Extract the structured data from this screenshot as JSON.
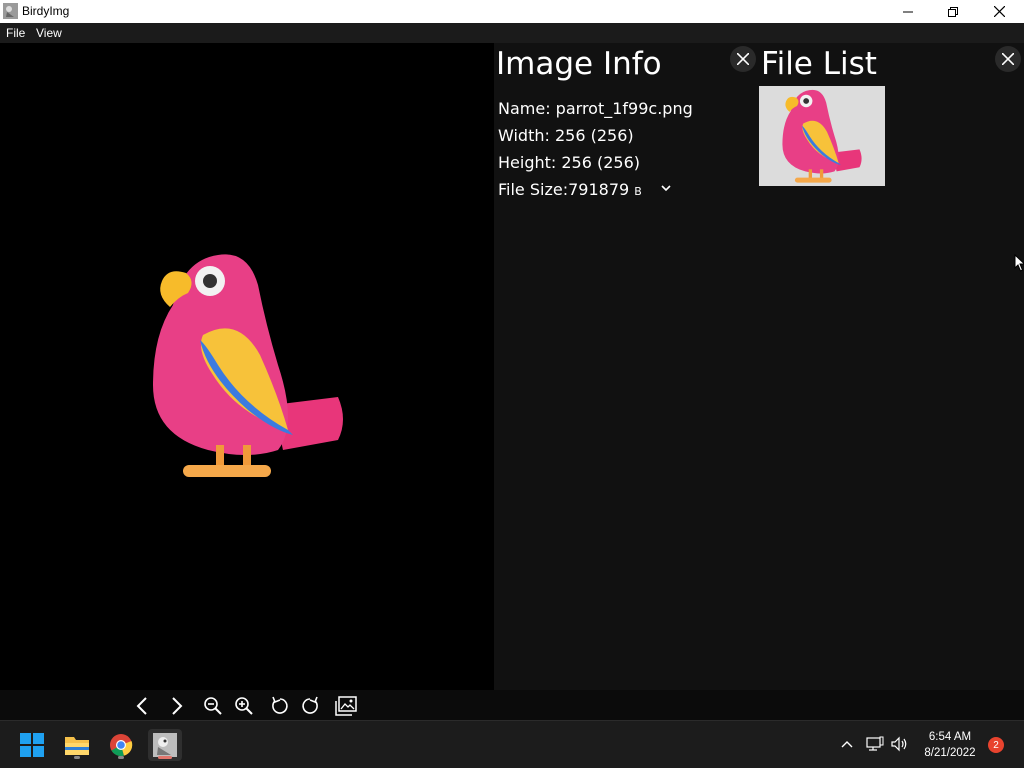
{
  "window": {
    "title": "BirdyImg"
  },
  "menu": {
    "file": "File",
    "view": "View"
  },
  "image_info": {
    "title": "Image Info",
    "name": "Name: parrot_1f99c.png",
    "width": "Width: 256 (256)",
    "height": "Height: 256 (256)",
    "file_size_label": "File Size:",
    "file_size_value": "791879",
    "file_size_unit": "B"
  },
  "file_list": {
    "title": "File List"
  },
  "taskbar": {
    "time": "6:54 AM",
    "date": "8/21/2022",
    "notification_count": "2"
  },
  "icons": {
    "close_panel": "close-icon",
    "prev": "chevron-left-icon",
    "next": "chevron-right-icon",
    "zoom_out": "zoom-out-icon",
    "zoom_in": "zoom-in-icon",
    "rotate_left": "rotate-left-icon",
    "rotate_right": "rotate-right-icon",
    "gallery": "gallery-icon"
  },
  "colors": {
    "panel_bg": "#111111",
    "toolbar_bg": "#0b0b0b",
    "badge": "#e8432e"
  }
}
